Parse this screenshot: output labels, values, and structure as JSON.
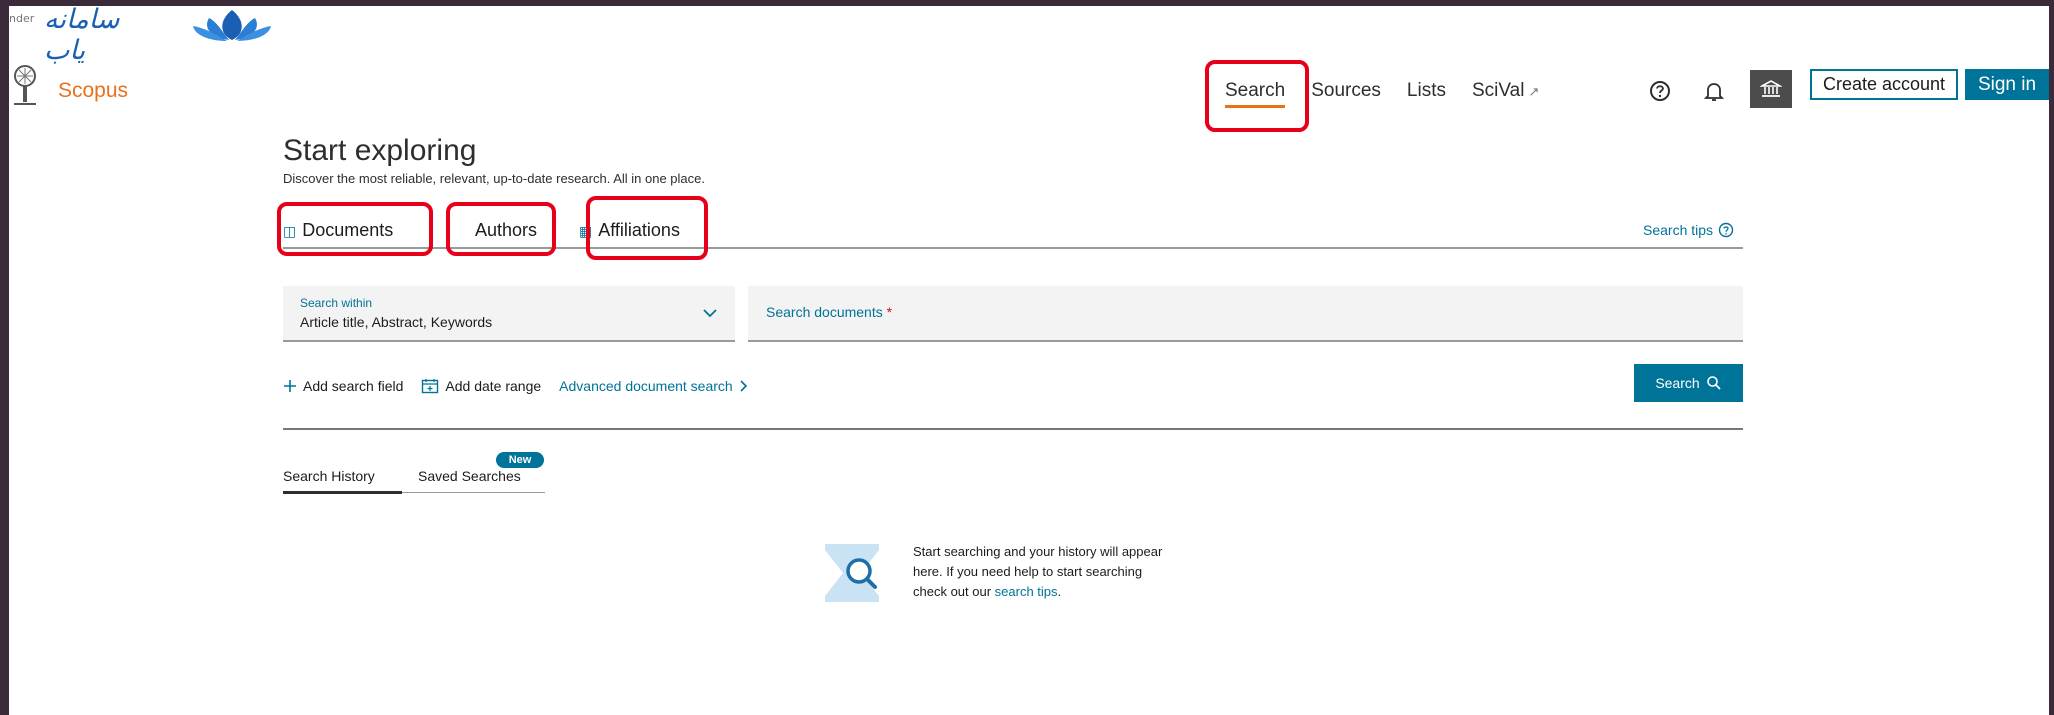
{
  "watermark": {
    "prefix": "nder",
    "persian_text": "سامانه یاب"
  },
  "brand": {
    "name": "Scopus"
  },
  "topnav": {
    "items": [
      {
        "label": "Search"
      },
      {
        "label": "Sources"
      },
      {
        "label": "Lists"
      },
      {
        "label": "SciVal",
        "ext": "↗"
      }
    ],
    "create_account": "Create account",
    "sign_in": "Sign in"
  },
  "hero": {
    "title": "Start exploring",
    "subtitle": "Discover the most reliable, relevant, up-to-date research. All in one place."
  },
  "tabs": [
    {
      "label": "Documents"
    },
    {
      "label": "Authors"
    },
    {
      "label": "Affiliations"
    }
  ],
  "search_tips": "Search tips",
  "search_within": {
    "label": "Search within",
    "value": "Article title, Abstract, Keywords"
  },
  "search_field": {
    "placeholder": "Search documents",
    "required_mark": "*"
  },
  "actions": {
    "add_field": "Add search field",
    "add_date": "Add date range",
    "advanced": "Advanced document search"
  },
  "search_button": "Search",
  "history": {
    "tab_history": "Search History",
    "tab_saved": "Saved Searches",
    "new_badge": "New",
    "empty_line1": "Start searching and your history will appear",
    "empty_line2": "here. If you need help to start searching",
    "empty_line3_prefix": "check out our ",
    "empty_link": "search tips",
    "empty_suffix": "."
  },
  "colors": {
    "accent": "#e9711c",
    "primary": "#007398",
    "highlight": "#e6001a",
    "frame": "#3b2a3a"
  }
}
